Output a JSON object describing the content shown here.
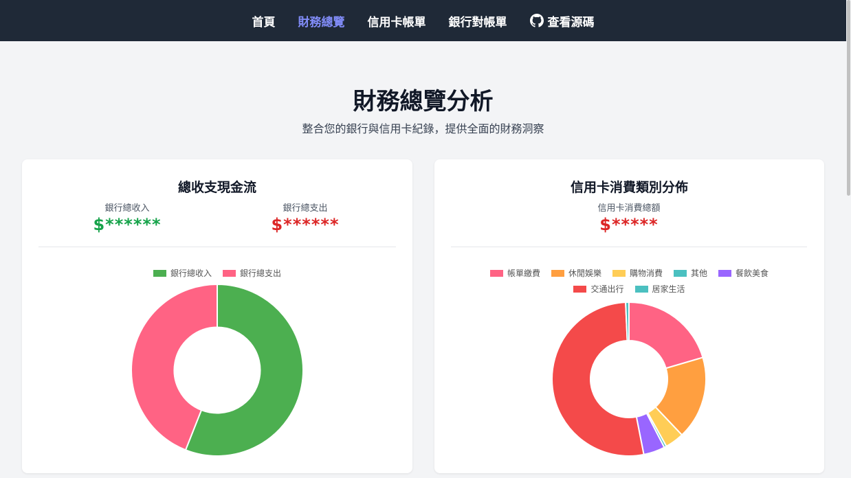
{
  "nav": {
    "items": [
      {
        "label": "首頁",
        "active": false
      },
      {
        "label": "財務總覽",
        "active": true
      },
      {
        "label": "信用卡帳單",
        "active": false
      },
      {
        "label": "銀行對帳單",
        "active": false
      }
    ],
    "source": {
      "label": "查看源碼",
      "icon": "github-icon"
    }
  },
  "hero": {
    "title": "財務總覽分析",
    "subtitle": "整合您的銀行與信用卡紀錄，提供全面的財務洞察"
  },
  "cashflow": {
    "title": "總收支現金流",
    "income_label": "銀行總收入",
    "income_value": "$******",
    "expense_label": "銀行總支出",
    "expense_value": "$******"
  },
  "categories": {
    "title": "信用卡消費類別分佈",
    "total_label": "信用卡消費總額",
    "total_value": "$*****"
  },
  "chart_data": [
    {
      "type": "pie",
      "donut": true,
      "labels": [
        "銀行總收入",
        "銀行總支出"
      ],
      "values": [
        56,
        44
      ],
      "colors": [
        "#4caf50",
        "#ff6384"
      ],
      "legend": "top"
    },
    {
      "type": "pie",
      "donut": true,
      "labels": [
        "帳單繳費",
        "休閒娛樂",
        "購物消費",
        "其他",
        "餐飲美食",
        "交通出行",
        "居家生活"
      ],
      "values": [
        20.5,
        17.5,
        4,
        0.5,
        4.5,
        52.5,
        0.7
      ],
      "colors": [
        "#ff6384",
        "#ff9f40",
        "#ffcd56",
        "#4bc0c0",
        "#9966ff",
        "#f44a4a",
        "#4bc0c0"
      ],
      "legend": "top"
    }
  ]
}
